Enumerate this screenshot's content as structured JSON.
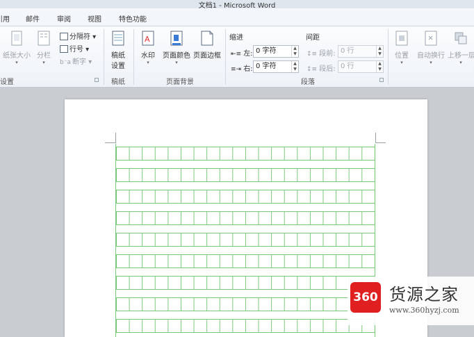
{
  "titlebar": {
    "title": "文档1 - Microsoft Word"
  },
  "menu": {
    "tabs": [
      "引用",
      "邮件",
      "审阅",
      "视图",
      "特色功能"
    ]
  },
  "ribbon": {
    "page_setup": {
      "label": "设置",
      "buttons": [
        "纸张大小",
        "分栏"
      ],
      "small": [
        "分隔符",
        "行号",
        "断字"
      ]
    },
    "manuscript": {
      "label": "稿纸",
      "button": [
        "稿纸",
        "设置"
      ]
    },
    "page_background": {
      "label": "页面背景",
      "buttons": [
        "水印",
        "页面颜色",
        "页面边框"
      ]
    },
    "paragraph": {
      "label": "段落",
      "indent_title": "缩进",
      "spacing_title": "间距",
      "indent_left_label": "左:",
      "indent_left_value": "0 字符",
      "indent_right_label": "右:",
      "indent_right_value": "0 字符",
      "space_before_label": "段前:",
      "space_before_value": "0 行",
      "space_after_label": "段后:",
      "space_after_value": "0 行"
    },
    "arrange": {
      "buttons": [
        "位置",
        "自动换行",
        "上移一层"
      ]
    }
  },
  "watermark": {
    "badge": "360",
    "name": "货源之家",
    "url": "www.360hyzj.com"
  },
  "colors": {
    "grid": "#79c779",
    "ribbon_bg": "#f3f6fa",
    "doc_bg": "#c9ccd1",
    "badge": "#e02020"
  }
}
